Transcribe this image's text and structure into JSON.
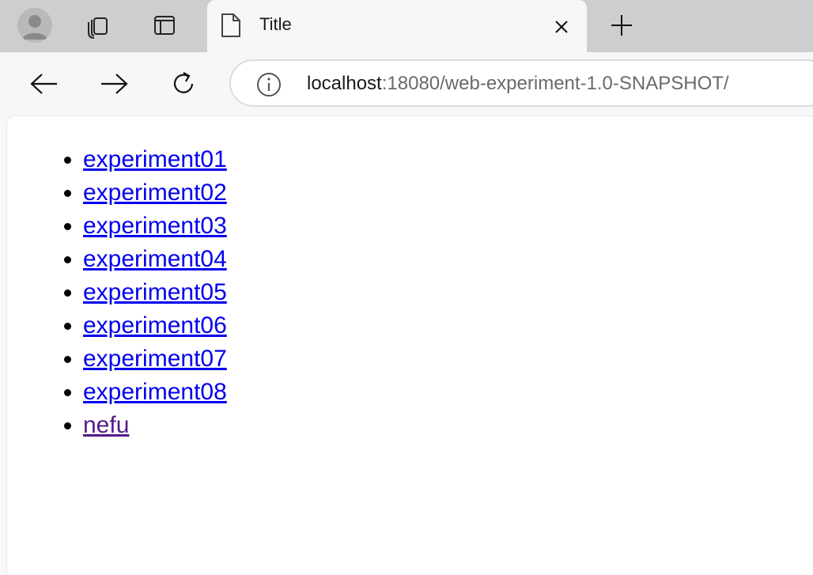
{
  "browser": {
    "tab": {
      "title": "Title",
      "close_icon": "close-icon",
      "page_icon": "document-icon"
    },
    "new_tab_icon": "plus-icon",
    "address": {
      "host": "localhost",
      "rest": ":18080/web-experiment-1.0-SNAPSHOT/",
      "info_icon": "info-icon"
    }
  },
  "page": {
    "links": [
      {
        "label": "experiment01",
        "visited": false
      },
      {
        "label": "experiment02",
        "visited": false
      },
      {
        "label": "experiment03",
        "visited": false
      },
      {
        "label": "experiment04",
        "visited": false
      },
      {
        "label": "experiment05",
        "visited": false
      },
      {
        "label": "experiment06",
        "visited": false
      },
      {
        "label": "experiment07",
        "visited": false
      },
      {
        "label": "experiment08",
        "visited": false
      },
      {
        "label": "nefu",
        "visited": true
      }
    ],
    "colors": {
      "link": "#0000ee",
      "visited_link": "#551a8b"
    }
  }
}
